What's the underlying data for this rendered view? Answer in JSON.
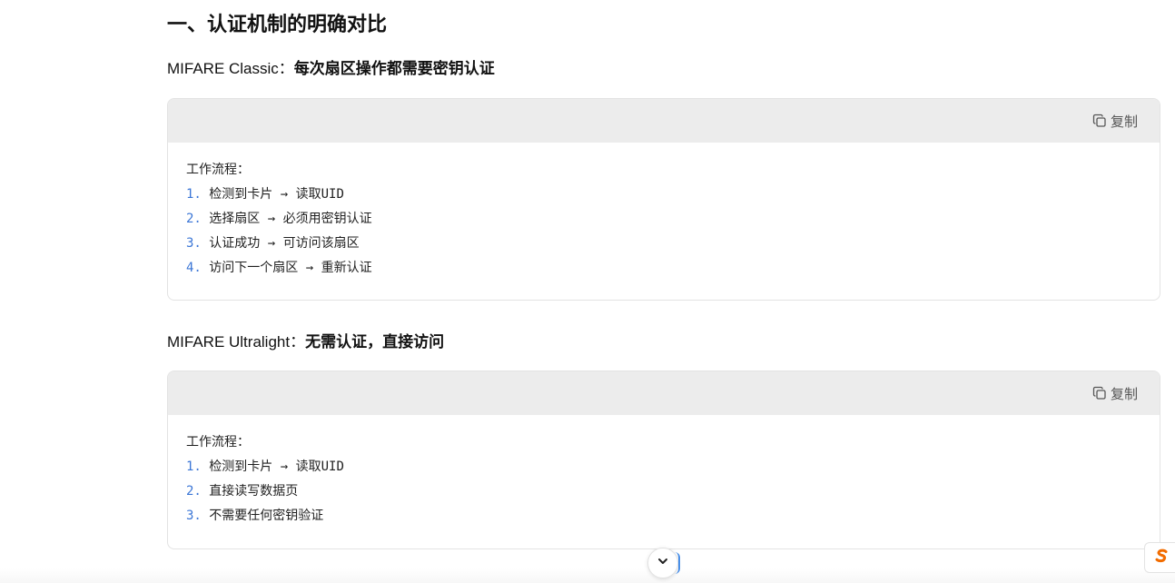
{
  "section_title": "一、认证机制的明确对比",
  "blocks": [
    {
      "heading_prefix": "MIFARE Classic：",
      "heading_strong": "每次扇区操作都需要密钥认证",
      "copy_label": "复制",
      "code_title": "工作流程：",
      "steps": [
        {
          "num": "1.",
          "text": "检测到卡片 → 读取UID"
        },
        {
          "num": "2.",
          "text": "选择扇区 → 必须用密钥认证"
        },
        {
          "num": "3.",
          "text": "认证成功 → 可访问该扇区"
        },
        {
          "num": "4.",
          "text": "访问下一个扇区 → 重新认证"
        }
      ]
    },
    {
      "heading_prefix": "MIFARE Ultralight：",
      "heading_strong": "无需认证，直接访问",
      "copy_label": "复制",
      "code_title": "工作流程：",
      "steps": [
        {
          "num": "1.",
          "text": "检测到卡片 → 读取UID"
        },
        {
          "num": "2.",
          "text": "直接读写数据页"
        },
        {
          "num": "3.",
          "text": "不需要任何密钥验证"
        }
      ]
    }
  ],
  "icons": {
    "copy": "copy-icon",
    "scroll": "chevron-down-icon",
    "corner": "s-logo-icon"
  },
  "colors": {
    "step_number": "#3b76d6",
    "code_header_bg": "#ececec",
    "corner_logo": "#f26c00"
  }
}
